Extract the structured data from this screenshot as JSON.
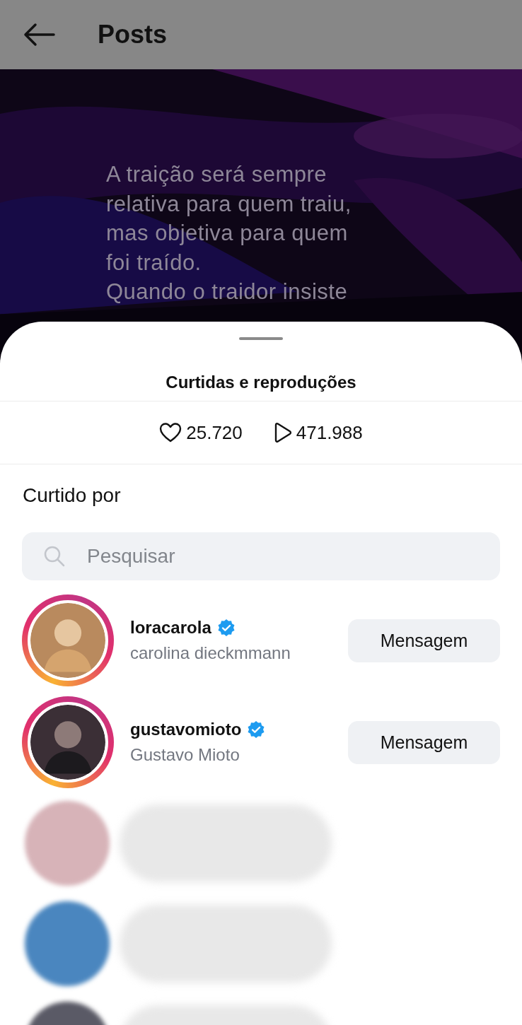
{
  "header": {
    "title": "Posts"
  },
  "post": {
    "kind": "picture",
    "quote": [
      "A traição será sempre",
      "relativa para quem traiu,",
      "mas objetiva para quem",
      "foi traído.",
      "Quando o traidor insiste"
    ]
  },
  "sheet": {
    "title": "Curtidas e reproduções",
    "likes": "25.720",
    "plays": "471.988",
    "section_title": "Curtido por",
    "search": {
      "placeholder": "Pesquisar"
    },
    "users": [
      {
        "kind": "user",
        "username": "loracarola",
        "name": "carolina dieckmmann",
        "verified": true,
        "story_ring": true,
        "button": "Mensagem"
      },
      {
        "kind": "user",
        "username": "gustavomioto",
        "name": "Gustavo Mioto",
        "verified": true,
        "story_ring": true,
        "button": "Mensagem"
      },
      {
        "kind": "blurred",
        "color": "#d7b3b8"
      },
      {
        "kind": "blurred",
        "color": "#4a86bf"
      },
      {
        "kind": "blurred",
        "color": "#5a5a66"
      }
    ]
  }
}
